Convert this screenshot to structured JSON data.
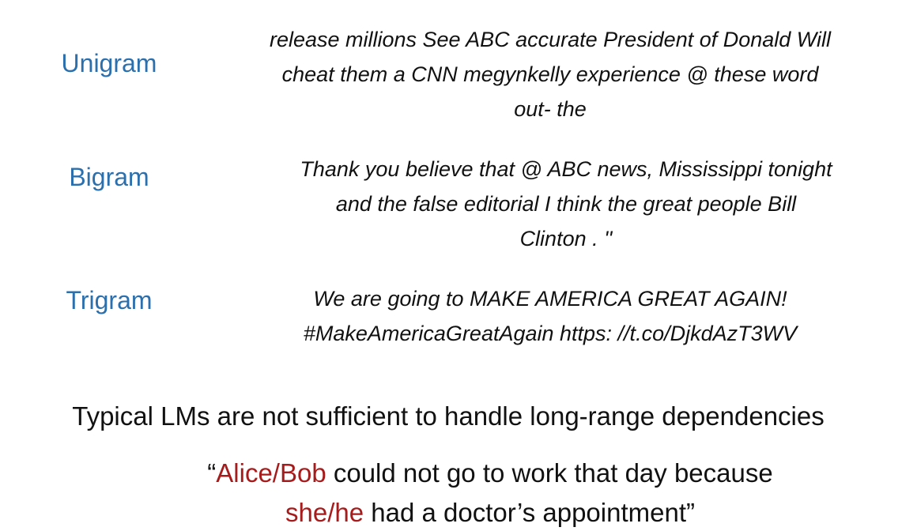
{
  "colors": {
    "label": "#2b6fad",
    "highlight": "#a61c1c",
    "text": "#111111"
  },
  "ngrams": [
    {
      "label": "Unigram",
      "lines": [
        "release millions See ABC accurate President of Donald Will",
        "cheat them a CNN megynkelly experience @ these word",
        "out- the"
      ]
    },
    {
      "label": "Bigram",
      "lines": [
        "Thank you believe that @ ABC news, Mississippi tonight",
        "and the false editorial I think the great people Bill",
        "Clinton . ''"
      ]
    },
    {
      "label": "Trigram",
      "lines": [
        "We are going to MAKE AMERICA GREAT AGAIN!",
        "#MakeAmericaGreatAgain https: //t.co/DjkdAzT3WV"
      ]
    }
  ],
  "statement": "Typical LMs are not sufficient to handle long-range dependencies",
  "quote": {
    "open_mark": "“",
    "subject1": "Alice/Bob",
    "rest1": " could not go to work that day because",
    "subject2": "she/he",
    "rest2": " had a doctor’s appointment",
    "close_mark": "”"
  }
}
